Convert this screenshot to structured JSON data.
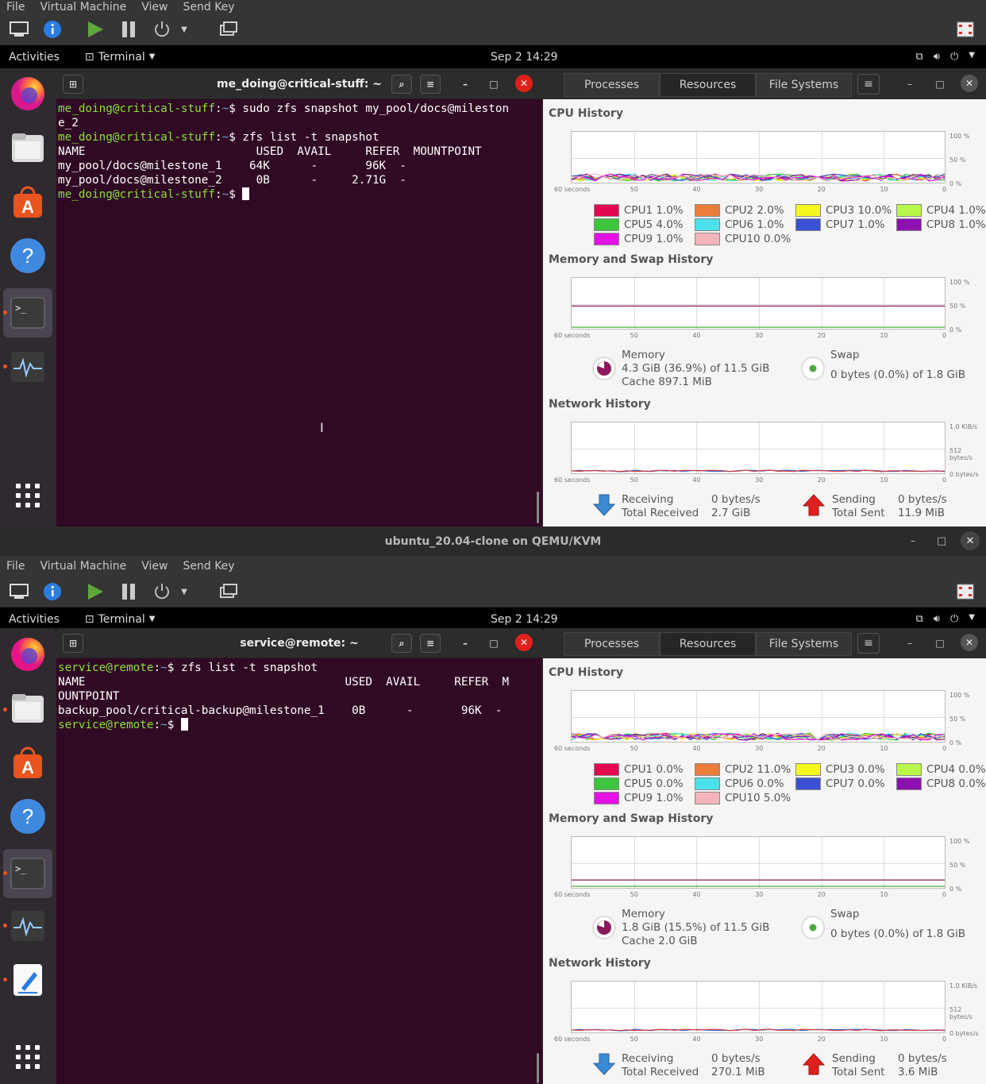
{
  "vm1": {
    "menu": [
      "File",
      "Virtual Machine",
      "View",
      "Send Key"
    ],
    "topbar": {
      "activities": "Activities",
      "app": "Terminal",
      "clock": "Sep 2  14:29"
    },
    "terminal": {
      "title": "me_doing@critical-stuff: ~",
      "lines": [
        {
          "user": "me_doing@critical-stuff",
          "path": "~",
          "cmd": "sudo zfs snapshot my_pool/docs@mileston"
        },
        {
          "text": "e_2"
        },
        {
          "user": "me_doing@critical-stuff",
          "path": "~",
          "cmd": "zfs list -t snapshot"
        },
        {
          "text": "NAME                         USED  AVAIL     REFER  MOUNTPOINT"
        },
        {
          "text": "my_pool/docs@milestone_1    64K      -       96K  -"
        },
        {
          "text": "my_pool/docs@milestone_2     0B      -     2.71G  -"
        },
        {
          "user": "me_doing@critical-stuff",
          "path": "~",
          "cmd": "",
          "cursor": true
        }
      ]
    },
    "sysmon": {
      "tabs": [
        "Processes",
        "Resources",
        "File Systems"
      ],
      "cpu_title": "CPU History",
      "cpus": [
        {
          "label": "CPU1  1.0%",
          "color": "#e4054f"
        },
        {
          "label": "CPU2  2.0%",
          "color": "#ec7c3a"
        },
        {
          "label": "CPU3  10.0%",
          "color": "#f8f81c"
        },
        {
          "label": "CPU4  1.0%",
          "color": "#b8f84a"
        },
        {
          "label": "CPU5  4.0%",
          "color": "#3cc43c"
        },
        {
          "label": "CPU6  1.0%",
          "color": "#4ce0ec"
        },
        {
          "label": "CPU7  1.0%",
          "color": "#3c50d4"
        },
        {
          "label": "CPU8  1.0%",
          "color": "#8c10b0"
        },
        {
          "label": "CPU9  1.0%",
          "color": "#e410e4"
        },
        {
          "label": "CPU10  0.0%",
          "color": "#f4b4bc"
        }
      ],
      "mem_title": "Memory and Swap History",
      "memory": {
        "label": "Memory",
        "value": "4.3 GiB (36.9%) of 11.5 GiB",
        "cache": "Cache 897.1 MiB",
        "percent": 36.9
      },
      "swap": {
        "label": "Swap",
        "value": "0 bytes (0.0%) of 1.8 GiB",
        "percent": 0
      },
      "net_title": "Network History",
      "net": {
        "recv_label": "Receiving",
        "recv_total_label": "Total Received",
        "recv_rate": "0 bytes/s",
        "recv_total": "2.7 GiB",
        "send_label": "Sending",
        "send_total_label": "Total Sent",
        "send_rate": "0 bytes/s",
        "send_total": "11.9 MiB"
      },
      "axis": {
        "x": [
          "60 seconds",
          "50",
          "40",
          "30",
          "20",
          "10",
          "0"
        ],
        "pct": [
          "100 %",
          "50 %",
          "0 %"
        ],
        "net": [
          "1.0 KiB/s",
          "512 bytes/s",
          "0 bytes/s"
        ]
      }
    }
  },
  "vm2": {
    "window_title": "ubuntu_20.04-clone on QEMU/KVM",
    "menu": [
      "File",
      "Virtual Machine",
      "View",
      "Send Key"
    ],
    "topbar": {
      "activities": "Activities",
      "app": "Terminal",
      "clock": "Sep 2  14:29"
    },
    "terminal": {
      "title": "service@remote: ~",
      "lines": [
        {
          "user": "service@remote",
          "path": "~",
          "cmd": "zfs list -t snapshot"
        },
        {
          "text": "NAME                                      USED  AVAIL     REFER  M"
        },
        {
          "text": "OUNTPOINT"
        },
        {
          "text": "backup_pool/critical-backup@milestone_1    0B      -       96K  -"
        },
        {
          "user": "service@remote",
          "path": "~",
          "cmd": "",
          "cursor": true
        }
      ]
    },
    "sysmon": {
      "tabs": [
        "Processes",
        "Resources",
        "File Systems"
      ],
      "cpu_title": "CPU History",
      "cpus": [
        {
          "label": "CPU1  0.0%",
          "color": "#e4054f"
        },
        {
          "label": "CPU2  11.0%",
          "color": "#ec7c3a"
        },
        {
          "label": "CPU3  0.0%",
          "color": "#f8f81c"
        },
        {
          "label": "CPU4  0.0%",
          "color": "#b8f84a"
        },
        {
          "label": "CPU5  0.0%",
          "color": "#3cc43c"
        },
        {
          "label": "CPU6  0.0%",
          "color": "#4ce0ec"
        },
        {
          "label": "CPU7  0.0%",
          "color": "#3c50d4"
        },
        {
          "label": "CPU8  0.0%",
          "color": "#8c10b0"
        },
        {
          "label": "CPU9  1.0%",
          "color": "#e410e4"
        },
        {
          "label": "CPU10  5.0%",
          "color": "#f4b4bc"
        }
      ],
      "mem_title": "Memory and Swap History",
      "memory": {
        "label": "Memory",
        "value": "1.8 GiB (15.5%) of 11.5 GiB",
        "cache": "Cache 2.0 GiB",
        "percent": 15.5
      },
      "swap": {
        "label": "Swap",
        "value": "0 bytes (0.0%) of 1.8 GiB",
        "percent": 0
      },
      "net_title": "Network History",
      "net": {
        "recv_label": "Receiving",
        "recv_total_label": "Total Received",
        "recv_rate": "0 bytes/s",
        "recv_total": "270.1 MiB",
        "send_label": "Sending",
        "send_total_label": "Total Sent",
        "send_rate": "0 bytes/s",
        "send_total": "3.6 MiB"
      },
      "axis": {
        "x": [
          "60 seconds",
          "50",
          "40",
          "30",
          "20",
          "10",
          "0"
        ],
        "pct": [
          "100 %",
          "50 %",
          "0 %"
        ],
        "net": [
          "1.0 KiB/s",
          "512 bytes/s",
          "0 bytes/s"
        ]
      }
    }
  },
  "icons": [
    "display-icon",
    "info-icon",
    "play-icon",
    "pause-icon",
    "power-icon",
    "dropdown-icon",
    "screenshot-icon",
    "fullscreen-icon",
    "firefox-icon",
    "files-icon",
    "software-icon",
    "help-icon",
    "terminal-icon",
    "system-monitor-icon",
    "text-editor-icon",
    "app-grid-icon"
  ]
}
